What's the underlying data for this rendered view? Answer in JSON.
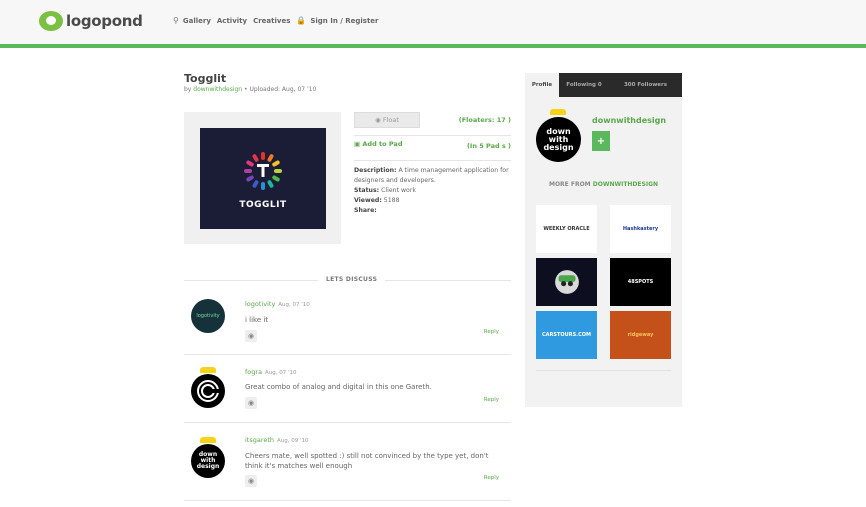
{
  "header": {
    "logo_text": "logopond",
    "nav": [
      "Gallery",
      "Activity",
      "Creatives",
      "Sign In / Register"
    ]
  },
  "logo": {
    "title": "Togglit",
    "by_prefix": "by",
    "author": "downwithdesign",
    "uploaded": "• Uploaded: Aug, 07 '10",
    "artwork_text": "TOGGLIT"
  },
  "actions": {
    "float_label": "Float",
    "floaters": "(Floaters: 17 )",
    "add_to_pad": "Add to Pad",
    "in_pads": "(In 5 Pad s )"
  },
  "details": {
    "description_label": "Description:",
    "description": "A time management application for designers and developers.",
    "status_label": "Status:",
    "status": "Client work",
    "viewed_label": "Viewed:",
    "viewed": "5188",
    "share_label": "Share:"
  },
  "discussion": {
    "heading": "LETS DISCUSS",
    "comments": [
      {
        "user": "logotivity",
        "date": "Aug, 07 '10",
        "text": "i like it",
        "reply": "Reply",
        "avatar_text": "logotivity"
      },
      {
        "user": "fogra",
        "date": "Aug, 07 '10",
        "text": "Great combo of analog and digital in this one Gareth.",
        "reply": "Reply"
      },
      {
        "user": "itsgareth",
        "date": "Aug, 09 '10",
        "text": "Cheers mate, well spotted :) still not convinced by the type yet, don't think it's matches well enough",
        "reply": "Reply",
        "avatar_text": "down with design"
      }
    ]
  },
  "sidebar": {
    "tabs": [
      "Profile",
      "Following 0",
      "300 Followers"
    ],
    "profile_name": "downwithdesign",
    "avatar_text": "down with design",
    "plus": "+",
    "more_prefix": "MORE FROM",
    "more_user": "DOWNWITHDESIGN",
    "thumbs": [
      {
        "text": "WEEKLY ORACLE",
        "bg": "#ffffff",
        "fg": "#333333"
      },
      {
        "text": "Hashkastery",
        "bg": "#ffffff",
        "fg": "#1b3a8f"
      },
      {
        "text": "",
        "bg": "#0d0f20",
        "fg": "#ffffff"
      },
      {
        "text": "48SPOTS",
        "bg": "#000000",
        "fg": "#ffffff"
      },
      {
        "text": "CARSTOURS.COM",
        "bg": "#2f9ae0",
        "fg": "#ffffff"
      },
      {
        "text": "ridgeway",
        "bg": "#c4501a",
        "fg": "#f6c35a"
      }
    ]
  },
  "colors": {
    "accent": "#5cb85c",
    "link": "#5aa84a",
    "artwork_bg": "#1b1d36"
  }
}
